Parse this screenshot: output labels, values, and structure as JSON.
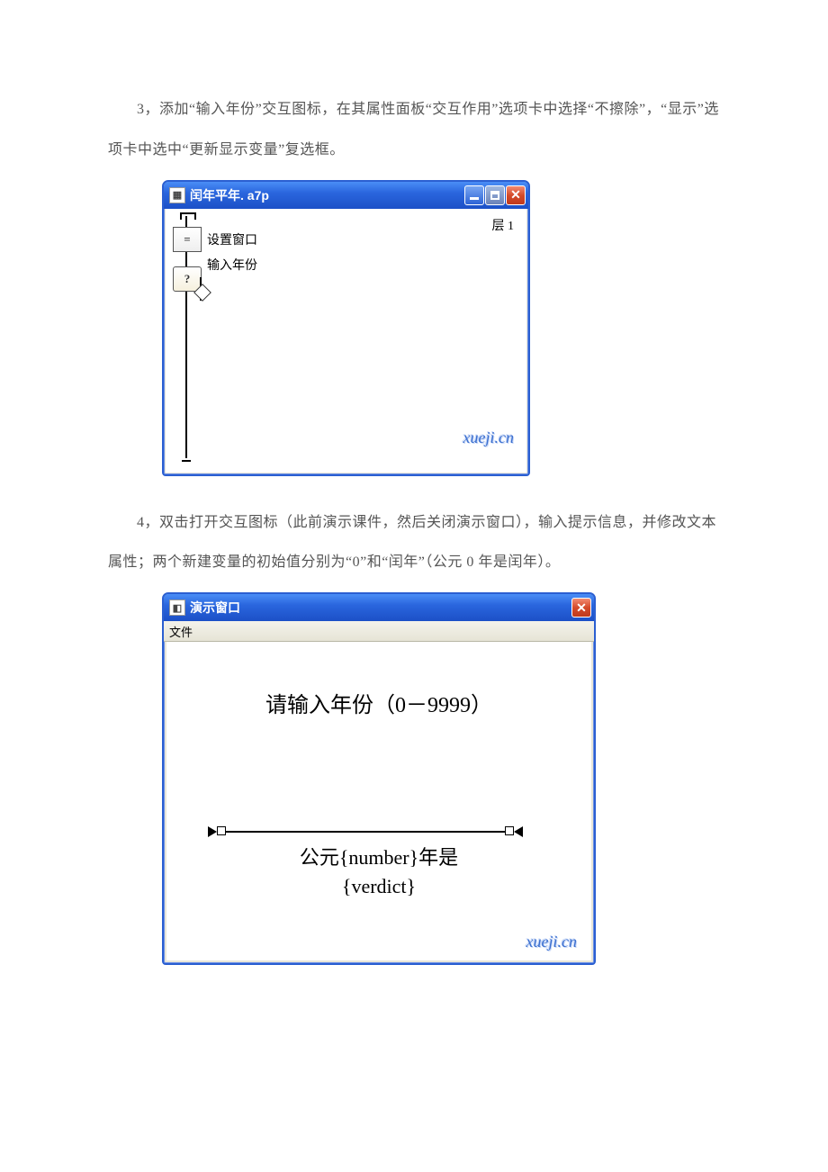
{
  "para1": "3，添加“输入年份”交互图标，在其属性面板“交互作用”选项卡中选择“不擦除”，“显示”选项卡中选中“更新显示变量”复选框。",
  "para2": "4，双击打开交互图标（此前演示课件，然后关闭演示窗口），输入提示信息，并修改文本属性；两个新建变量的初始值分别为“0”和“闰年”（公元 0 年是闰年）。",
  "window1": {
    "title": "闰年平年. a7p",
    "level": "层 1",
    "icon1_label": "设置窗口",
    "icon2_label": "输入年份"
  },
  "window2": {
    "title": "演示窗口",
    "menu_file": "文件",
    "prompt": "请输入年份（0－9999）",
    "result_line1": "公元{number}年是",
    "result_line2": "{verdict}"
  },
  "watermark": "xueji.cn"
}
